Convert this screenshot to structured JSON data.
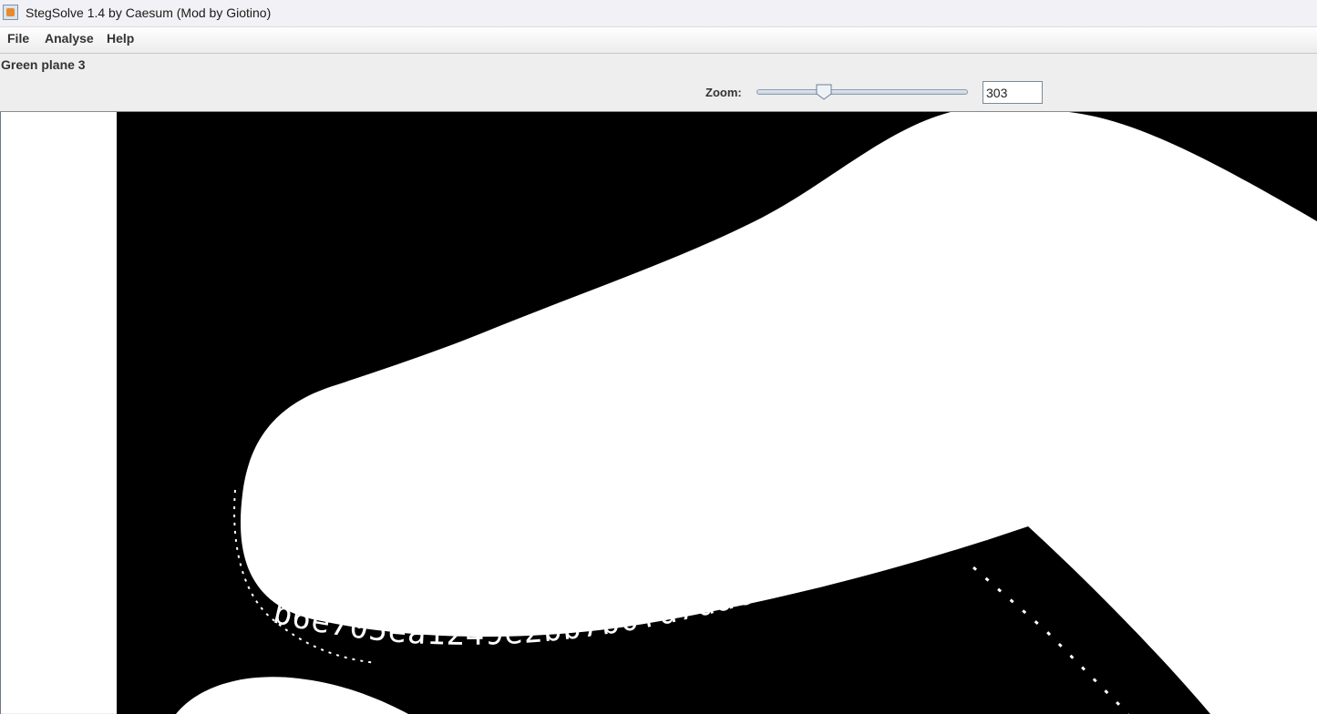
{
  "window": {
    "title": "StegSolve 1.4 by Caesum (Mod by Giotino)",
    "icon": "java-cup-icon"
  },
  "menu": {
    "items": [
      {
        "label": "File"
      },
      {
        "label": "Analyse"
      },
      {
        "label": "Help"
      }
    ]
  },
  "view": {
    "plane_label": "Green plane 3",
    "zoom_label": "Zoom:",
    "zoom_value": "303",
    "zoom_slider_fraction": 0.3
  },
  "image": {
    "hidden_text": "b6e705ea1249e2bb7b0fd7dac9fc0fe",
    "colors": {
      "foreground": "#ffffff",
      "background": "#000000"
    }
  }
}
